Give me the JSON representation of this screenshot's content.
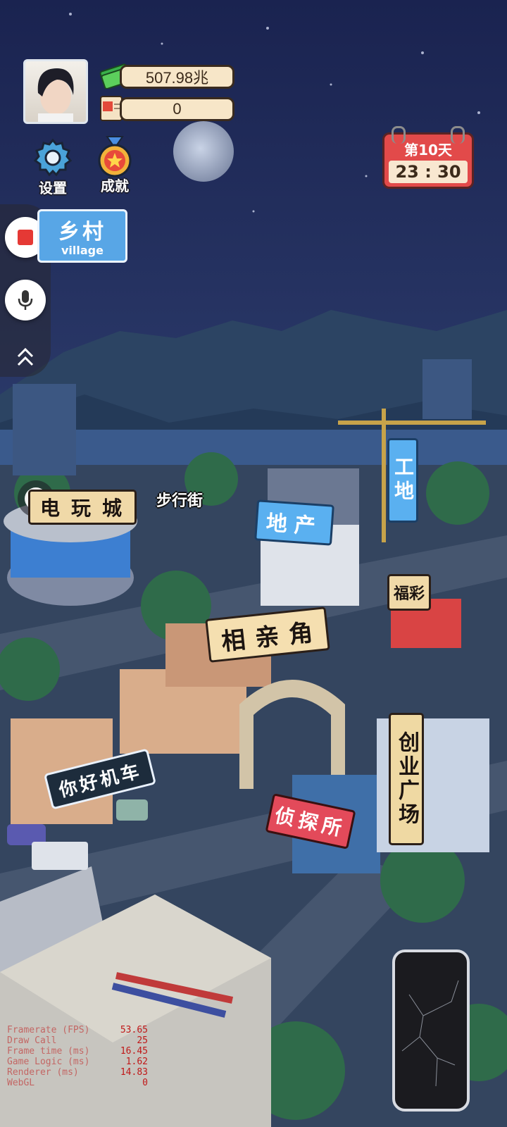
{
  "hud": {
    "money": "507.98兆",
    "tickets": "0",
    "settings_label": "设置",
    "achievement_label": "成就",
    "day_label": "第10天",
    "time": "23 : 30"
  },
  "location": {
    "name_cn": "乡村",
    "name_en": "village"
  },
  "places": {
    "arcade": "电玩城",
    "pedestrian_street": "步行街",
    "real_estate": "地产",
    "construction": "工地",
    "lottery": "福彩",
    "blind_date": "相亲角",
    "motorbike": "你好机车",
    "detective": "侦探所",
    "startup_plaza": "创业广场"
  },
  "debug": [
    {
      "label": "Framerate (FPS)",
      "value": "53.65"
    },
    {
      "label": "Draw Call",
      "value": "25"
    },
    {
      "label": "Frame time (ms)",
      "value": "16.45"
    },
    {
      "label": "Game Logic (ms)",
      "value": "1.62"
    },
    {
      "label": "Renderer (ms)",
      "value": "14.83"
    },
    {
      "label": "WebGL",
      "value": "0"
    }
  ],
  "colors": {
    "sky": "#1c2550",
    "hill": "#2c4463",
    "road": "#3b4a66",
    "record": "#e53935",
    "calendar": "#e24a4a"
  }
}
